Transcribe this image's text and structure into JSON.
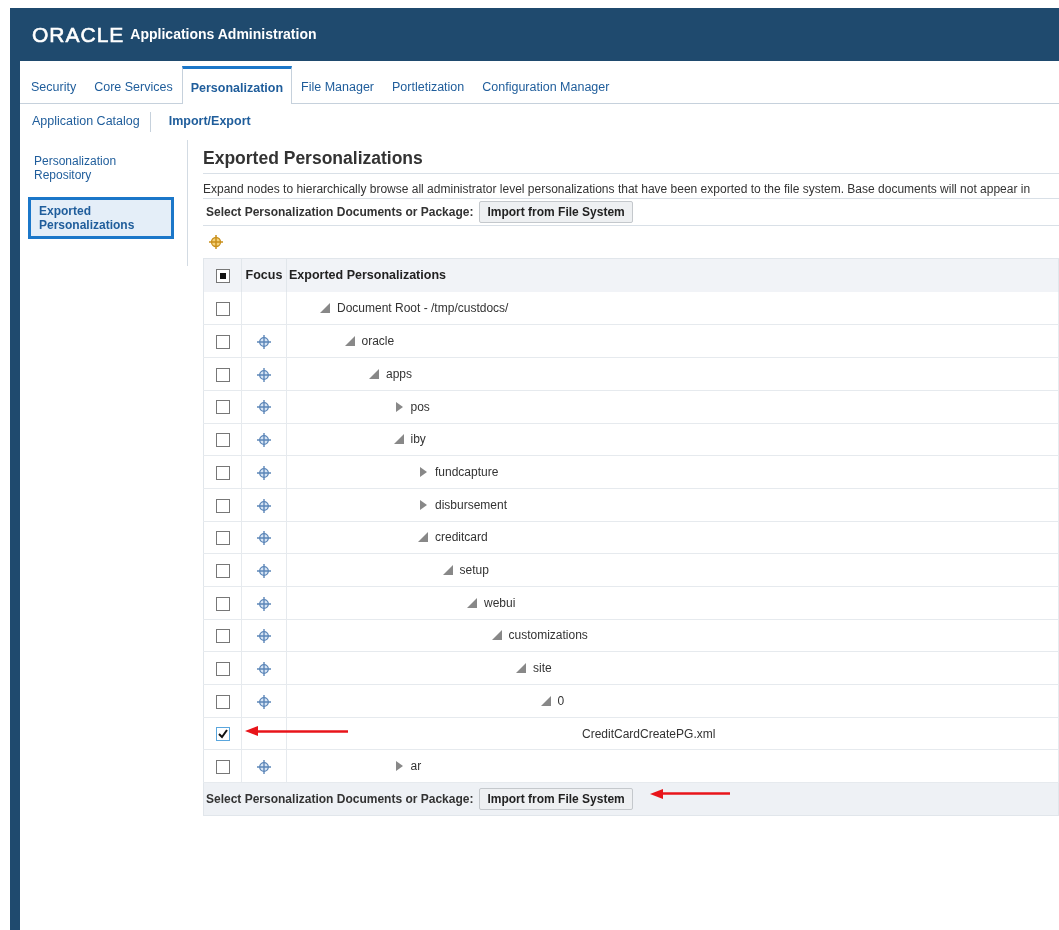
{
  "header": {
    "logo": "ORACLE",
    "title": "Applications Administration"
  },
  "tabs": [
    {
      "label": "Security",
      "selected": false
    },
    {
      "label": "Core Services",
      "selected": false
    },
    {
      "label": "Personalization",
      "selected": true
    },
    {
      "label": "File Manager",
      "selected": false
    },
    {
      "label": "Portletization",
      "selected": false
    },
    {
      "label": "Configuration Manager",
      "selected": false
    }
  ],
  "subtabs": [
    {
      "label": "Application Catalog",
      "selected": false
    },
    {
      "label": "Import/Export",
      "selected": true
    }
  ],
  "sidebar": {
    "items": [
      {
        "label": "Personalization Repository",
        "selected": false
      },
      {
        "label": "Exported Personalizations",
        "selected": true
      }
    ]
  },
  "main": {
    "title": "Exported Personalizations",
    "description": "Expand nodes to hierarchically browse all administrator level personalizations that have been exported to the file system. Base documents will not appear in",
    "toolbar": {
      "label": "Select Personalization Documents or Package:",
      "button": "Import from File System"
    },
    "table": {
      "columns": [
        "Focus",
        "Exported Personalizations"
      ],
      "select_all_indeterminate": true,
      "rows": [
        {
          "kind": "folder",
          "label": "Document Root - /tmp/custdocs/",
          "expanded": true,
          "checked": false,
          "focusable": false,
          "children": [
            {
              "kind": "folder",
              "label": "oracle",
              "expanded": true,
              "checked": false,
              "focusable": true,
              "children": [
                {
                  "kind": "folder",
                  "label": "apps",
                  "expanded": true,
                  "checked": false,
                  "focusable": true,
                  "children": [
                    {
                      "kind": "folder",
                      "label": "pos",
                      "expanded": false,
                      "checked": false,
                      "focusable": true
                    },
                    {
                      "kind": "folder",
                      "label": "iby",
                      "expanded": true,
                      "checked": false,
                      "focusable": true,
                      "children": [
                        {
                          "kind": "folder",
                          "label": "fundcapture",
                          "expanded": false,
                          "checked": false,
                          "focusable": true
                        },
                        {
                          "kind": "folder",
                          "label": "disbursement",
                          "expanded": false,
                          "checked": false,
                          "focusable": true
                        },
                        {
                          "kind": "folder",
                          "label": "creditcard",
                          "expanded": true,
                          "checked": false,
                          "focusable": true,
                          "children": [
                            {
                              "kind": "folder",
                              "label": "setup",
                              "expanded": true,
                              "checked": false,
                              "focusable": true,
                              "children": [
                                {
                                  "kind": "folder",
                                  "label": "webui",
                                  "expanded": true,
                                  "checked": false,
                                  "focusable": true,
                                  "children": [
                                    {
                                      "kind": "folder",
                                      "label": "customizations",
                                      "expanded": true,
                                      "checked": false,
                                      "focusable": true,
                                      "children": [
                                        {
                                          "kind": "folder",
                                          "label": "site",
                                          "expanded": true,
                                          "checked": false,
                                          "focusable": true,
                                          "children": [
                                            {
                                              "kind": "folder",
                                              "label": "0",
                                              "expanded": true,
                                              "checked": false,
                                              "focusable": true,
                                              "children": [
                                                {
                                                  "kind": "file",
                                                  "label": "CreditCardCreatePG.xml",
                                                  "checked": true,
                                                  "focusable": false
                                                }
                                              ]
                                            }
                                          ]
                                        }
                                      ]
                                    }
                                  ]
                                }
                              ]
                            }
                          ]
                        }
                      ]
                    },
                    {
                      "kind": "folder",
                      "label": "ar",
                      "expanded": false,
                      "checked": false,
                      "focusable": true
                    }
                  ]
                }
              ]
            }
          ]
        }
      ]
    },
    "footer": {
      "label": "Select Personalization Documents or Package:",
      "button": "Import from File System"
    }
  }
}
